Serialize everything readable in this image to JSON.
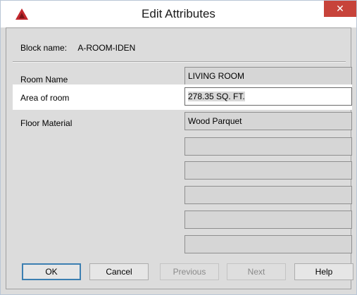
{
  "window": {
    "title": "Edit Attributes",
    "app_icon": "autocad-triangle-icon",
    "close_icon": "close-icon"
  },
  "block": {
    "label": "Block name:",
    "value": "A-ROOM-IDEN"
  },
  "attributes": [
    {
      "label": "Room Name",
      "value": "LIVING ROOM",
      "active": false
    },
    {
      "label": "Area of room",
      "value": "278.35 SQ. FT.",
      "active": true
    },
    {
      "label": "Floor Material",
      "value": "Wood Parquet",
      "active": false
    }
  ],
  "empty_fields": 5,
  "buttons": {
    "ok": "OK",
    "cancel": "Cancel",
    "previous": "Previous",
    "next": "Next",
    "help": "Help"
  },
  "colors": {
    "close_red": "#c7433a",
    "icon_red": "#c1272d",
    "default_button_border": "#3c7fb1"
  }
}
